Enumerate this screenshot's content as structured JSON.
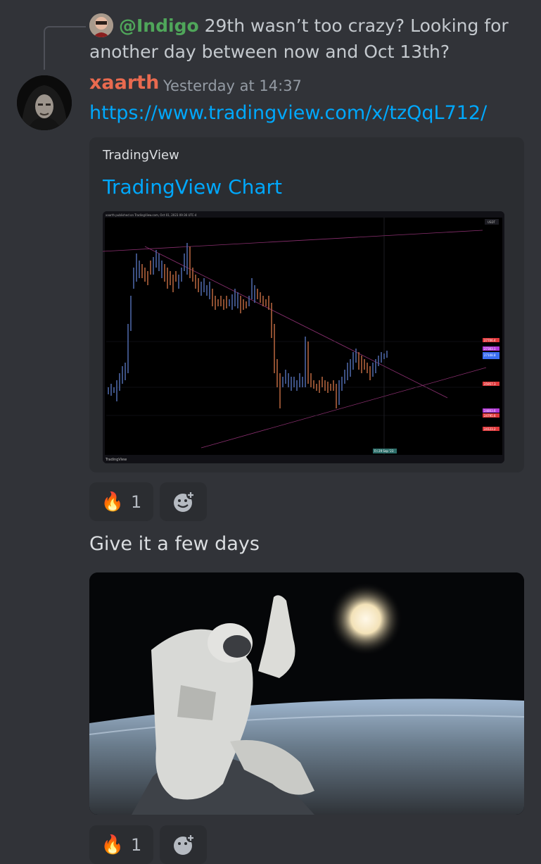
{
  "reply": {
    "mention": "@Indigo",
    "text": "29th wasn’t too crazy? Looking for another day between now and Oct 13th?"
  },
  "message": {
    "author": "xaarth",
    "timestamp": "Yesterday at 14:37",
    "link": "https://www.tradingview.com/x/tzQqL712/",
    "embed": {
      "provider": "TradingView",
      "title": "TradingView Chart",
      "chart": {
        "header": "xaarth published on TradingView.com, Oct 01, 2023 09:36 UTC-4",
        "symbol": "USDT",
        "footer_logo": "TradingView",
        "date_label": "Fri 29 Sep '23",
        "price_labels": [
          {
            "text": "27706.4",
            "color": "#e0383b"
          },
          {
            "text": "27303.1",
            "color": "#b23ad6"
          },
          {
            "text": "27108.8",
            "color": "#3b6ff2"
          },
          {
            "text": "25957.3",
            "color": "#e0383b"
          },
          {
            "text": "24803.6",
            "color": "#b23ad6"
          },
          {
            "text": "24795.6",
            "color": "#e0383b"
          },
          {
            "text": "24123.2",
            "color": "#e0383b"
          }
        ]
      }
    },
    "reactions": [
      {
        "emoji": "🔥",
        "count": "1"
      }
    ],
    "add_reaction_icon": "add-reaction-icon",
    "second_text": "Give it a few days",
    "gif": {
      "subject": "astronaut-waving-above-earth"
    },
    "reactions2": [
      {
        "emoji": "🔥",
        "count": "1"
      }
    ]
  },
  "colors": {
    "background": "#313338",
    "embed": "#2b2d31",
    "author": "#e96a4f",
    "mention": "#4fa65a",
    "link": "#00a8fc"
  }
}
